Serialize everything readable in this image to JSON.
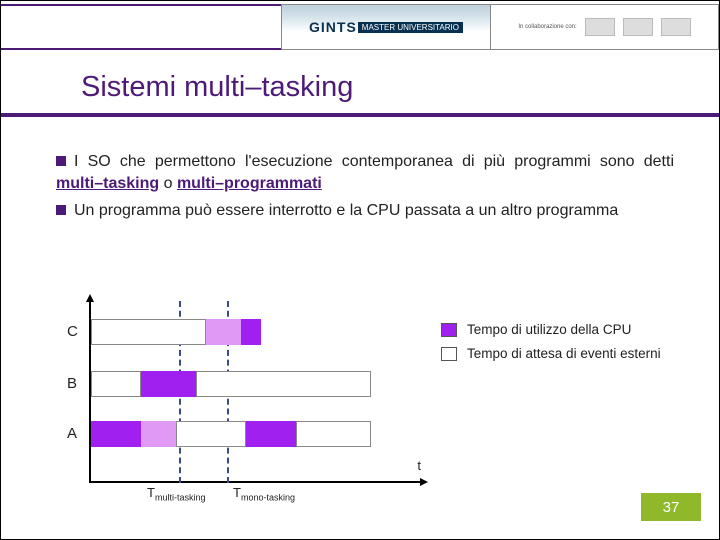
{
  "header": {
    "brand_name": "GINTS",
    "brand_badge": "MASTER UNIVERSITARIO",
    "collab_label": "In collaborazione con:"
  },
  "title": "Sistemi multi–tasking",
  "body": {
    "p1_pre": "I SO che permettono l'esecuzione contemporanea di più programmi sono detti ",
    "term1": "multi–tasking",
    "p1_mid": " o ",
    "term2": "multi–programmati",
    "p2": "Un programma può essere interrotto e la CPU passata a un altro programma"
  },
  "chart_data": {
    "type": "bar",
    "rows": [
      "C",
      "B",
      "A"
    ],
    "x_axis_label": "t",
    "markers": [
      "Tmulti-tasking",
      "Tmono-tasking"
    ],
    "series": [
      {
        "name": "cpu",
        "color": "#a020f0",
        "legend": "Tempo di utilizzo della CPU"
      },
      {
        "name": "wait",
        "color": "#ffffff",
        "legend": "Tempo di attesa di eventi esterni"
      }
    ],
    "segments": {
      "C": [
        {
          "start": 0,
          "end": 46,
          "type": "wait"
        },
        {
          "start": 46,
          "end": 60,
          "type": "cpu-light"
        },
        {
          "start": 60,
          "end": 68,
          "type": "cpu"
        }
      ],
      "B": [
        {
          "start": 0,
          "end": 20,
          "type": "wait"
        },
        {
          "start": 20,
          "end": 42,
          "type": "cpu"
        },
        {
          "start": 42,
          "end": 112,
          "type": "wait"
        }
      ],
      "A": [
        {
          "start": 0,
          "end": 20,
          "type": "cpu"
        },
        {
          "start": 20,
          "end": 34,
          "type": "cpu-light"
        },
        {
          "start": 34,
          "end": 62,
          "type": "wait"
        },
        {
          "start": 62,
          "end": 82,
          "type": "cpu"
        },
        {
          "start": 82,
          "end": 112,
          "type": "wait"
        }
      ]
    },
    "vlines_pct": [
      31,
      47
    ]
  },
  "legend": {
    "cpu": "Tempo di utilizzo della CPU",
    "wait": "Tempo di attesa di eventi esterni"
  },
  "page_number": "37"
}
